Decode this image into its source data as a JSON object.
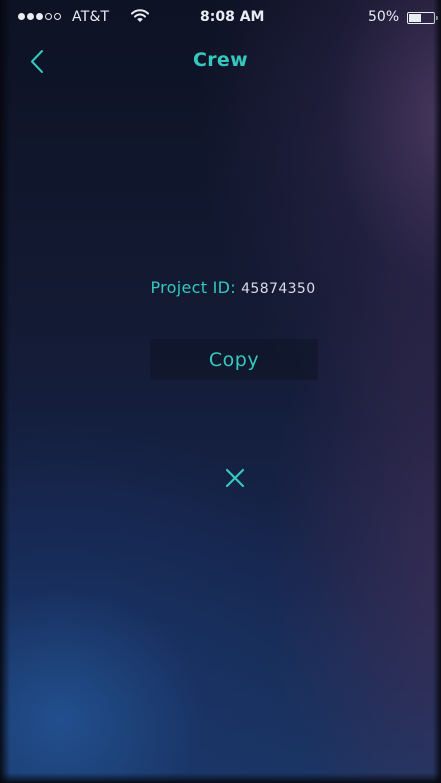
{
  "status_bar": {
    "signal_bars_filled": 3,
    "signal_bars_total": 5,
    "carrier": "AT&T",
    "time": "8:08 AM",
    "battery_percent": "50%",
    "battery_level": 0.5
  },
  "nav": {
    "title": "Crew",
    "back_icon": "chevron-left-icon"
  },
  "project": {
    "label": "Project ID:",
    "value": "45874350"
  },
  "actions": {
    "copy_label": "Copy",
    "close_icon": "close-icon"
  },
  "colors": {
    "accent": "#35c8bf",
    "text_light": "#e8ecf3"
  }
}
